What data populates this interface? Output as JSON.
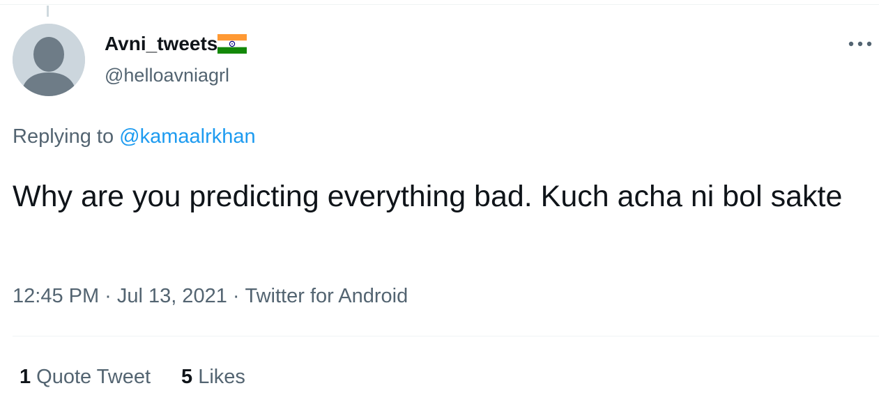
{
  "user": {
    "display_name": "Avni_tweets",
    "handle": "@helloavniagrl",
    "flag_icon": "india-flag-icon",
    "avatar_icon": "default-avatar-icon"
  },
  "menu": {
    "more_icon": "more-horizontal-icon"
  },
  "reply": {
    "prefix": "Replying to",
    "mention": "@kamaalrkhan"
  },
  "tweet": {
    "text": "Why are you predicting everything bad. Kuch acha ni bol sakte"
  },
  "meta": {
    "time": "12:45 PM",
    "separator": "·",
    "date": "Jul 13, 2021",
    "source": "Twitter for Android"
  },
  "stats": {
    "quote_count": "1",
    "quote_label": "Quote Tweet",
    "like_count": "5",
    "like_label": "Likes"
  },
  "colors": {
    "text_primary": "#0f1419",
    "text_secondary": "#536471",
    "link": "#1d9bf0",
    "divider": "#eff3f4",
    "avatar_bg": "#ccd6dd",
    "avatar_fg": "#6e7c87"
  }
}
